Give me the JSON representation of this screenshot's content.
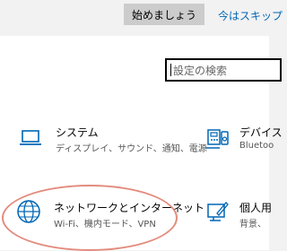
{
  "header": {
    "start_label": "始めましょう",
    "skip_label": "今はスキップ"
  },
  "search": {
    "placeholder": "設定の検索"
  },
  "tiles": [
    {
      "title": "システム",
      "desc": "ディスプレイ、サウンド、通知、電源",
      "icon": "laptop-icon"
    },
    {
      "title": "デバイス",
      "desc": "Bluetoo",
      "icon": "devices-icon"
    },
    {
      "title": "ネットワークとインターネット",
      "desc": "Wi-Fi、機内モード、VPN",
      "icon": "globe-icon"
    },
    {
      "title": "個人用",
      "desc": "背景、",
      "icon": "personalization-icon"
    }
  ],
  "colors": {
    "accent": "#0066b4",
    "highlight_ring": "#e28c7e"
  }
}
